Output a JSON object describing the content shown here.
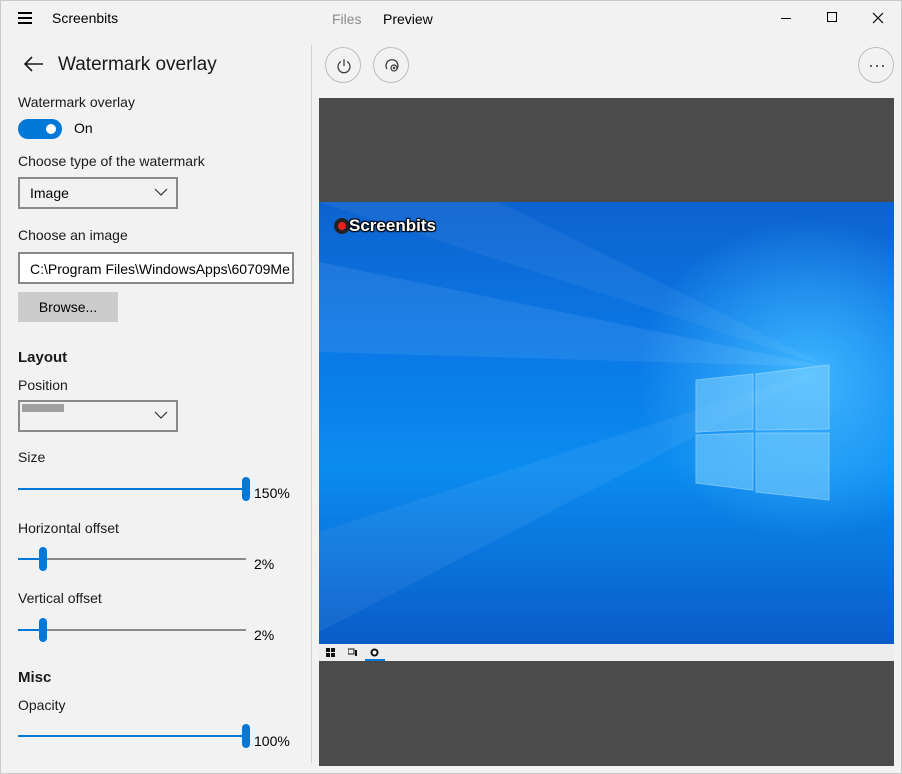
{
  "app": {
    "title": "Screenbits"
  },
  "tabs": [
    {
      "label": "Files",
      "active": false
    },
    {
      "label": "Preview",
      "active": true
    }
  ],
  "settings": {
    "page_title": "Watermark overlay",
    "overlay_label": "Watermark overlay",
    "overlay_state": "On",
    "type_label": "Choose type of the watermark",
    "type_value": "Image",
    "image_label": "Choose an image",
    "image_path": "C:\\Program Files\\WindowsApps\\60709Me",
    "browse_label": "Browse...",
    "layout_heading": "Layout",
    "position_label": "Position",
    "size_label": "Size",
    "size_value": "150%",
    "size_fraction": 1.0,
    "hoffset_label": "Horizontal offset",
    "hoffset_value": "2%",
    "hoffset_fraction": 0.11,
    "voffset_label": "Vertical offset",
    "voffset_value": "2%",
    "voffset_fraction": 0.11,
    "misc_heading": "Misc",
    "opacity_label": "Opacity",
    "opacity_value": "100%",
    "opacity_fraction": 1.0
  },
  "preview": {
    "watermark_text": "Screenbits",
    "accent": "#0078d7"
  },
  "icons": [
    "hamburger-icon",
    "back-arrow-icon",
    "power-icon",
    "record-icon",
    "more-icon",
    "chevron-down-icon",
    "minimize-icon",
    "maximize-icon",
    "close-icon"
  ]
}
